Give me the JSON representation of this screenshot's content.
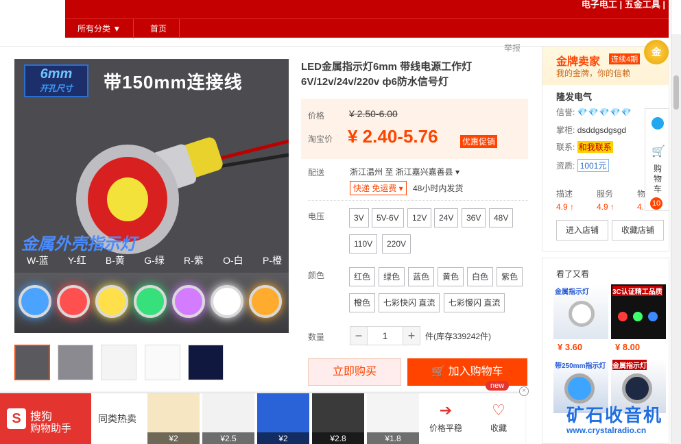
{
  "header": {
    "shop_title_partial": "电子电工 | 五金工具 |",
    "nav": [
      "所有分类 ▼",
      "首页"
    ]
  },
  "report_label": "举报",
  "gallery": {
    "badge_big": "6mm",
    "badge_small": "开孔尺寸",
    "headline": "带150mm连接线",
    "subheadline": "金属外壳指示灯",
    "colors": [
      "W-蓝",
      "Y-红",
      "B-黄",
      "G-绿",
      "R-紫",
      "O-白",
      "P-橙"
    ]
  },
  "product": {
    "title": "LED金属指示灯6mm 带线电源工作灯6V/12v/24v/220v ф6防水信号灯",
    "price_label": "价格",
    "old_price": "¥ 2.50-6.00",
    "tb_price_label": "淘宝价",
    "new_price": "¥ 2.40-5.76",
    "promo": "优惠促销",
    "ship_label": "配送",
    "ship_from": "浙江温州 至  浙江嘉兴嘉善县 ▾",
    "ship_fee": "快递 免运费 ▾",
    "ship_time": "48小时内发货",
    "voltage_label": "电压",
    "voltages": [
      "3V",
      "5V-6V",
      "12V",
      "24V",
      "36V",
      "48V",
      "110V",
      "220V"
    ],
    "color_label": "颜色",
    "colors": [
      "红色",
      "绿色",
      "蓝色",
      "黄色",
      "白色",
      "紫色",
      "橙色",
      "七彩快闪 直流",
      "七彩慢闪 直流"
    ],
    "qty_label": "数量",
    "qty_minus": "−",
    "qty_value": "1",
    "qty_plus": "+",
    "stock": "件(库存339242件)",
    "buy_now": "立即购买",
    "add_cart": "加入购物车"
  },
  "shop": {
    "gold_title": "金牌卖家",
    "gold_tag": "连续4期",
    "gold_sub": "我的金牌，你的信赖",
    "medal": "金",
    "name": "隆发电气",
    "credit_label": "信誉:",
    "credit_val": "💎💎💎💎💎",
    "keeper_label": "掌柜:",
    "keeper_val": "dsddgsdgsgd",
    "contact_label": "联系:",
    "contact_val": "和我联系",
    "qual_label": "资质:",
    "qual_val": "1001元",
    "scores": [
      {
        "label": "描述",
        "value": "4.9 ↑"
      },
      {
        "label": "服务",
        "value": "4.9 ↑"
      },
      {
        "label": "物",
        "value": "4."
      }
    ],
    "enter_btn": "进入店铺",
    "fav_btn": "收藏店铺",
    "side_cart": "购物车",
    "cart_count": "10"
  },
  "also": {
    "title": "看了又看",
    "items": [
      {
        "price": "¥ 3.60",
        "caption": "金属指示灯"
      },
      {
        "price": "¥ 8.00",
        "caption": "3C认证精工品质"
      },
      {
        "price": "",
        "caption": "带250mm指示灯"
      },
      {
        "price": "",
        "caption": "金属指示灯"
      }
    ]
  },
  "sogou": {
    "logo_line1": "搜狗",
    "logo_line2": "购物助手",
    "hot_label": "同类热卖",
    "products": [
      "¥2",
      "¥2.5",
      "¥2",
      "¥2.8",
      "¥1.8"
    ],
    "price_trend": "价格平稳",
    "favorite": "收藏",
    "new_tag": "new"
  },
  "watermark": {
    "cn": "矿石收音机",
    "url": "www.crystalradio.cn"
  }
}
